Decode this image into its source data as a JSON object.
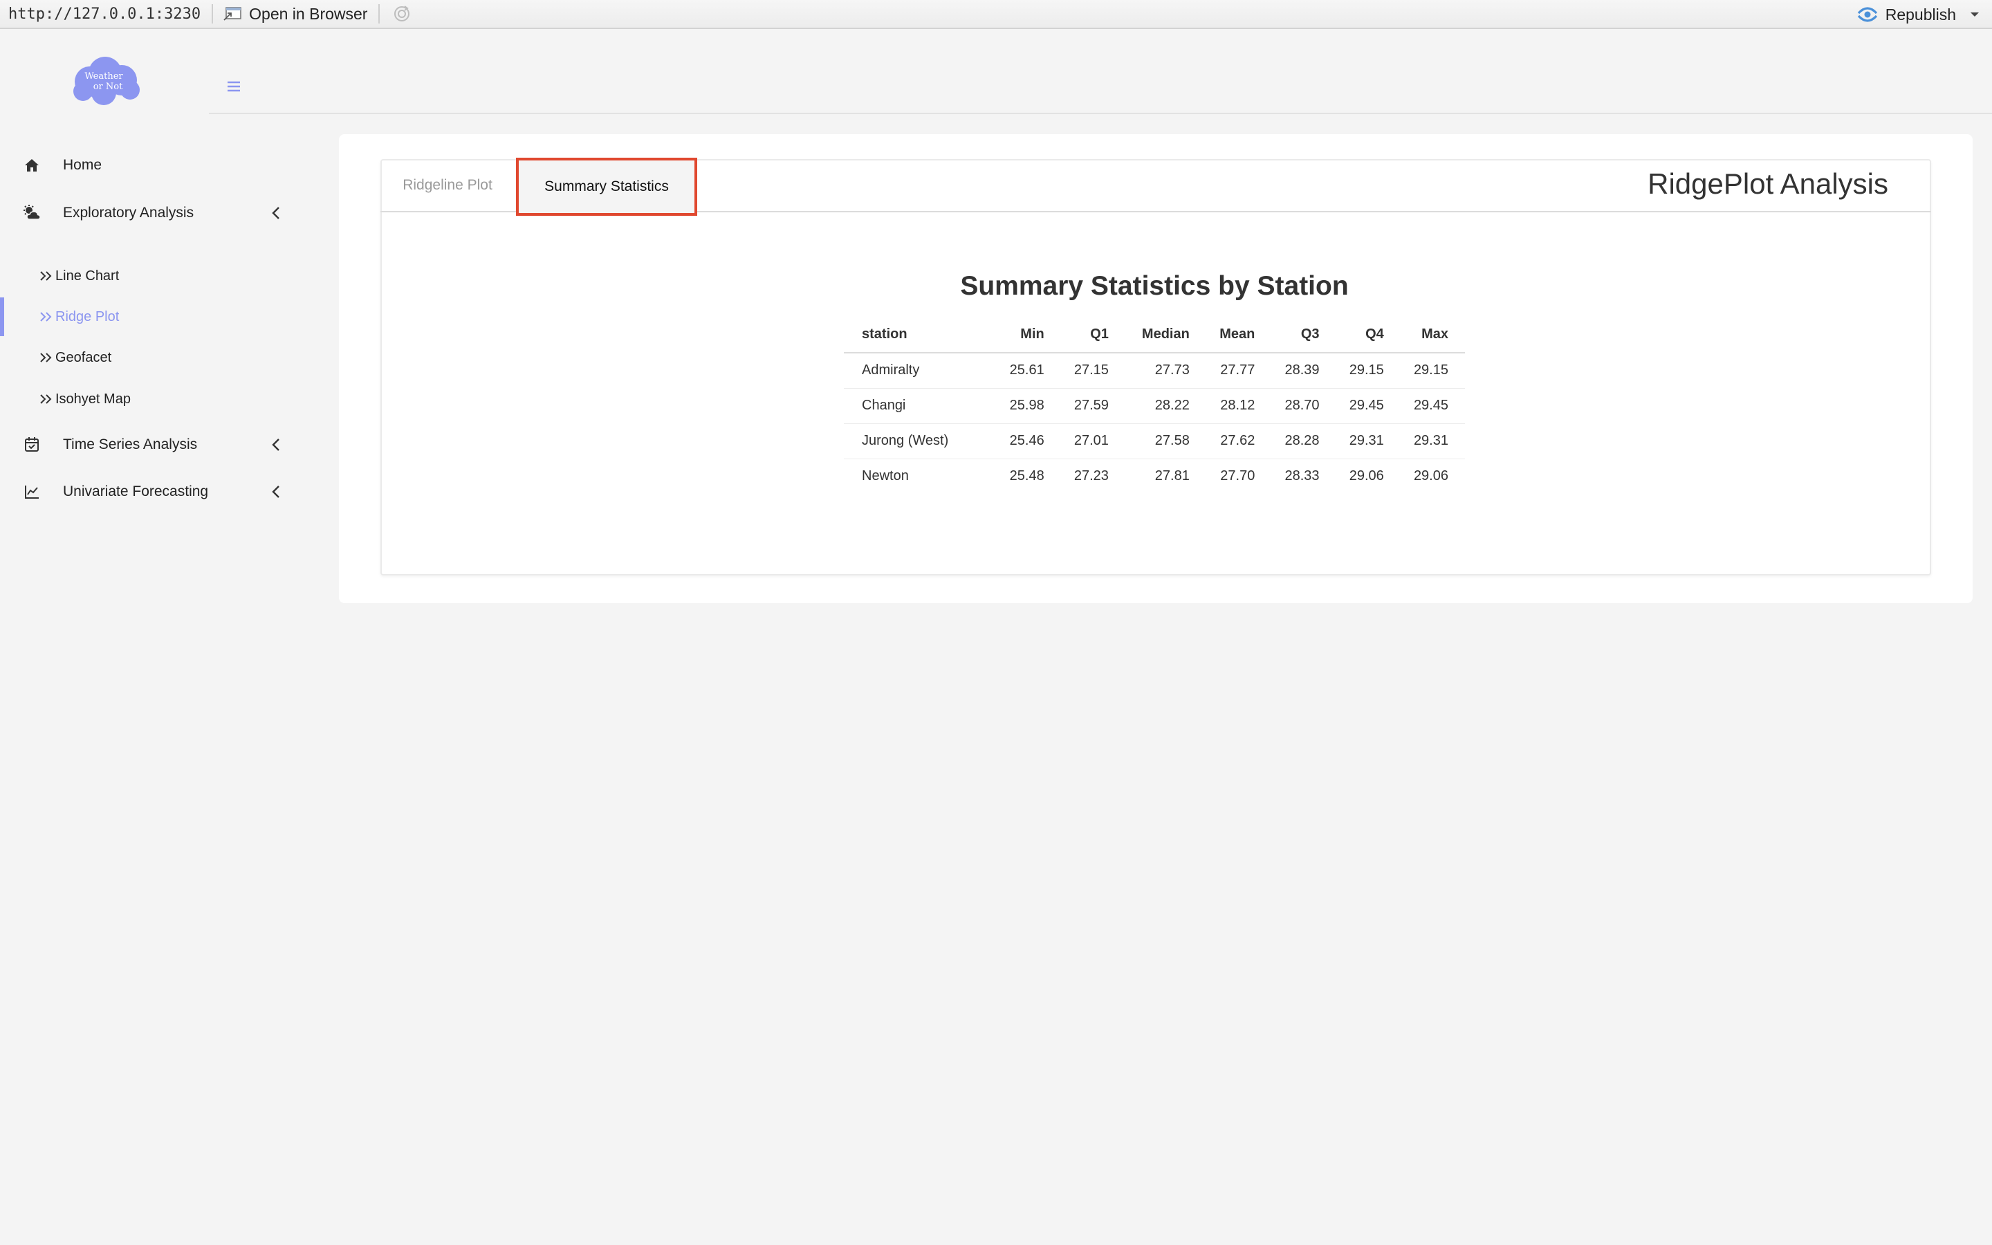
{
  "topbar": {
    "url": "http://127.0.0.1:3230",
    "open_browser_label": "Open in Browser",
    "republish_label": "Republish"
  },
  "sidebar": {
    "logo_text": [
      "Weather",
      "or Not"
    ],
    "items": [
      {
        "label": "Home",
        "icon": "home-icon"
      },
      {
        "label": "Exploratory Analysis",
        "icon": "cloud-sun-icon"
      },
      {
        "label": "Time Series Analysis",
        "icon": "calendar-check-icon"
      },
      {
        "label": "Univariate Forecasting",
        "icon": "line-chart-icon"
      }
    ],
    "subitems": [
      {
        "label": "Line Chart"
      },
      {
        "label": "Ridge Plot",
        "active": true
      },
      {
        "label": "Geofacet"
      },
      {
        "label": "Isohyet Map"
      }
    ],
    "accent_color": "#8c96f0"
  },
  "tabs": [
    {
      "label": "Ridgeline Plot",
      "active": false
    },
    {
      "label": "Summary Statistics",
      "active": true
    }
  ],
  "panel_title": "RidgePlot Analysis",
  "table": {
    "title": "Summary Statistics by Station",
    "columns": [
      "station",
      "Min",
      "Q1",
      "Median",
      "Mean",
      "Q3",
      "Q4",
      "Max"
    ],
    "rows": [
      [
        "Admiralty",
        "25.61",
        "27.15",
        "27.73",
        "27.77",
        "28.39",
        "29.15",
        "29.15"
      ],
      [
        "Changi",
        "25.98",
        "27.59",
        "28.22",
        "28.12",
        "28.70",
        "29.45",
        "29.45"
      ],
      [
        "Jurong (West)",
        "25.46",
        "27.01",
        "27.58",
        "27.62",
        "28.28",
        "29.31",
        "29.31"
      ],
      [
        "Newton",
        "25.48",
        "27.23",
        "27.81",
        "27.70",
        "28.33",
        "29.06",
        "29.06"
      ]
    ]
  },
  "highlight_color": "#e0482f"
}
